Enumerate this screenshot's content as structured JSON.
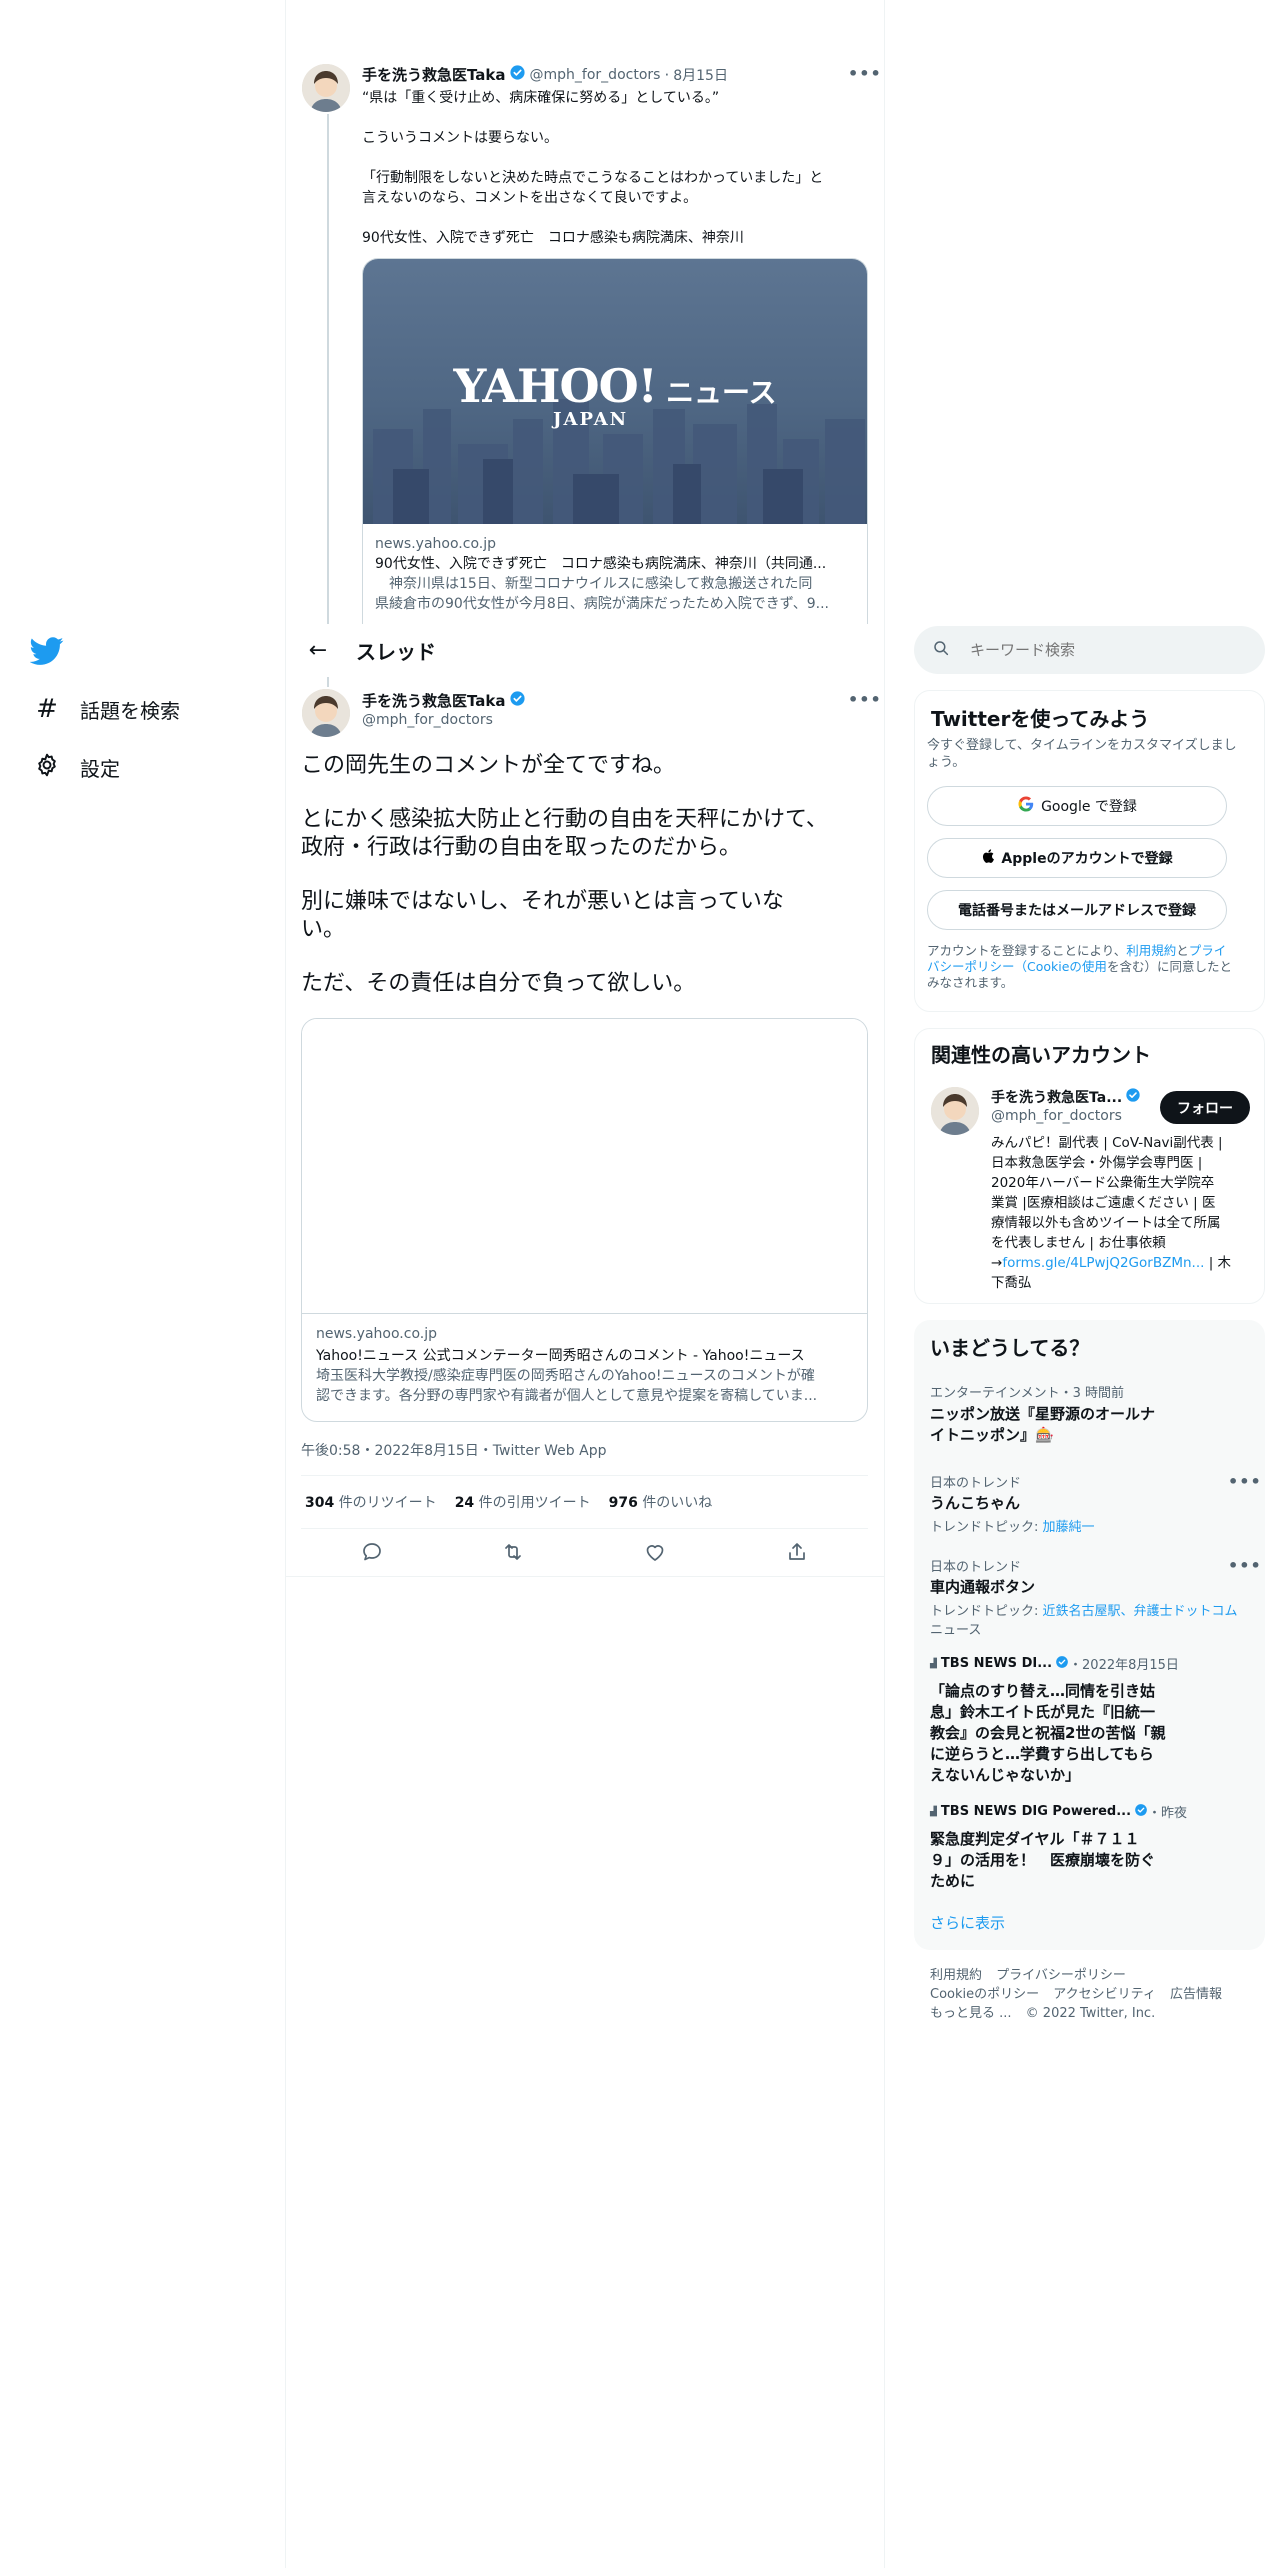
{
  "nav": {
    "explore_label": "話題を検索",
    "settings_label": "設定"
  },
  "header": {
    "back_glyph": "←",
    "title": "スレッド"
  },
  "search": {
    "placeholder": "キーワード検索"
  },
  "parent_tweet": {
    "name": "手を洗う救急医Taka",
    "handle": "@mph_for_doctors",
    "dot": "·",
    "date": "8月15日",
    "lines": [
      "“県は「重く受け止め、病床確保に努める」としている。”",
      "こういうコメントは要らない。",
      "「行動制限をしないと決めた時点でこうなることはわかっていました」と",
      "言えないのなら、コメントを出さなくて良いですよ。",
      "90代女性、入院できず死亡　コロナ感染も病院満床、神奈川"
    ],
    "card": {
      "logo_main": "YAHOO!",
      "logo_sub": "JAPAN",
      "logo_news": "ニュース",
      "domain": "news.yahoo.co.jp",
      "title": "90代女性、入院できず死亡　コロナ感染も病院満床、神奈川（共同通...",
      "desc1": "　神奈川県は15日、新型コロナウイルスに感染して救急搬送された同",
      "desc2": "県綾倉市の90代女性が今月8日、病院が満床だったため入院できず、9..."
    }
  },
  "main_tweet": {
    "name": "手を洗う救急医Taka",
    "handle": "@mph_for_doctors",
    "lines": [
      "この岡先生のコメントが全てですね。",
      "とにかく感染拡大防止と行動の自由を天秤にかけて、",
      "政府・行政は行動の自由を取ったのだから。",
      "別に嫌味ではないし、それが悪いとは言っていな",
      "い。",
      "ただ、その責任は自分で負って欲しい。"
    ],
    "card": {
      "domain": "news.yahoo.co.jp",
      "title": "Yahoo!ニュース 公式コメンテーター岡秀昭さんのコメント - Yahoo!ニュース",
      "desc1": "埼玉医科大学教授/感染症専門医の岡秀昭さんのYahoo!ニュースのコメントが確",
      "desc2": "認できます。各分野の専門家や有識者が個人として意見や提案を寄稿していま..."
    },
    "timestamp": "午後0:58・2022年8月15日・Twitter Web App",
    "stats": {
      "retweets": "304",
      "retweets_label": "件のリツイート",
      "quotes": "24",
      "quotes_label": "件の引用ツイート",
      "likes": "976",
      "likes_label": "件のいいね"
    }
  },
  "signup": {
    "title": "Twitterを使ってみよう",
    "subtitle1": "今すぐ登録して、タイムラインをカスタマイズしまし",
    "subtitle2": "ょう。",
    "google_label": "Google で登録",
    "apple_label": "Appleのアカウントで登録",
    "phone_label": "電話番号またはメールアドレスで登録",
    "legal_1": "アカウントを登録することにより、",
    "legal_terms": "利用規約",
    "legal_and": "と",
    "legal_privacy": "プライ",
    "legal_2": "バシーポリシー（Cookieの使用",
    "legal_3": "を含む）に同意したと",
    "legal_4": "みなされます。"
  },
  "related": {
    "title": "関連性の高いアカウント",
    "name": "手を洗う救急医Ta...",
    "handle": "@mph_for_doctors",
    "follow_label": "フォロー",
    "bio_lines": [
      "みんパピ！副代表 | CoV-Navi副代表 |",
      "日本救急医学会・外傷学会専門医 |",
      "2020年ハーバード公衆衛生大学院卒",
      "業賞 |医療相談はご遠慮ください | 医",
      "療情報以外も含めツイートは全て所属",
      "を代表しません | お仕事依頼"
    ],
    "bio_link_prefix": "→",
    "bio_link": "forms.gle/4LPwjQ2GorBZMn...",
    "bio_suffix": " | 木",
    "bio_last": "下喬弘"
  },
  "trends": {
    "title": "いまどうしてる？",
    "items": [
      {
        "label": "エンターテインメント・3 時間前",
        "title1": "ニッポン放送『星野源のオールナ",
        "title2": "イトニッポン』🎰"
      },
      {
        "label": "日本のトレンド",
        "title1": "うんこちゃん",
        "topic_prefix": "トレンドトピック: ",
        "topic": "加藤純一"
      },
      {
        "label": "日本のトレンド",
        "title1": "車内通報ボタン",
        "topic_prefix": "トレンドトピック: ",
        "topic": "近鉄名古屋駅、弁護士ドットコム",
        "topic2": "ニュース"
      },
      {
        "source": "TBS NEWS DI...",
        "time": "・2022年8月15日",
        "lines": [
          "「論点のすり替え…同情を引き姑",
          "息」鈴木エイト氏が見た『旧統一",
          "教会』の会見と祝福2世の苦悩「親",
          "に逆らうと…学費すら出してもら",
          "えないんじゃないか」"
        ]
      },
      {
        "source": "TBS NEWS DIG Powered...",
        "time": "・昨夜",
        "lines": [
          "緊急度判定ダイヤル「＃７１１",
          "９」の活用を！　医療崩壊を防ぐ",
          "ために"
        ]
      }
    ],
    "show_more": "さらに表示"
  },
  "footer": {
    "row1": [
      "利用規約",
      "プライバシーポリシー"
    ],
    "row2": [
      "Cookieのポリシー",
      "アクセシビリティ",
      "広告情報"
    ],
    "more": "もっと見る ...",
    "copyright": "© 2022 Twitter, Inc."
  },
  "colors": {
    "accent": "#1d9bf0",
    "text": "#0f1419",
    "muted": "#536471",
    "border": "#eff3f4",
    "panel": "#f7f9f9"
  }
}
